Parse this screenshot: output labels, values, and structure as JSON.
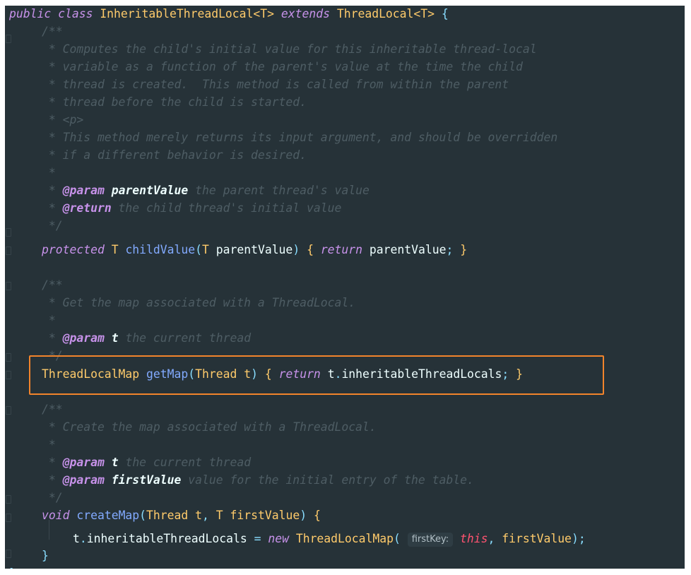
{
  "code": {
    "l1": {
      "kw1": "public",
      "kw2": "class",
      "cls": "InheritableThreadLocal",
      "tp1": "<T>",
      "kw3": "extends",
      "sup": "ThreadLocal",
      "tp2": "<T>",
      "brace": "{"
    },
    "l2": {
      "text": "/**"
    },
    "l3": {
      "text": " * Computes the child's initial value for this inheritable thread-local"
    },
    "l4": {
      "text": " * variable as a function of the parent's value at the time the child"
    },
    "l5": {
      "text": " * thread is created.  This method is called from within the parent"
    },
    "l6": {
      "text": " * thread before the child is started."
    },
    "l7": {
      "text": " * <p>"
    },
    "l8": {
      "text": " * This method merely returns its input argument, and should be overridden"
    },
    "l9": {
      "text": " * if a different behavior is desired."
    },
    "l10": {
      "text": " *"
    },
    "l11": {
      "star": " * ",
      "tag": "@param",
      "param": "parentValue",
      "desc": " the parent thread's value"
    },
    "l12": {
      "star": " * ",
      "tag": "@return",
      "desc": " the child thread's initial value"
    },
    "l13": {
      "text": " */"
    },
    "l14": {
      "kw": "protected",
      "type": "T",
      "fn": "childValue",
      "open": "(",
      "ptype": "T",
      "pname": "parentValue",
      "close": ")",
      "b1": "{",
      "ret": "return",
      "val": "parentValue",
      "semi": ";",
      "b2": "}"
    },
    "l15": {
      "text": "/**"
    },
    "l16": {
      "text": " * Get the map associated with a ThreadLocal."
    },
    "l17": {
      "text": " *"
    },
    "l18": {
      "star": " * ",
      "tag": "@param",
      "param": "t",
      "desc": " the current thread"
    },
    "l19": {
      "text": " */"
    },
    "l20": {
      "type": "ThreadLocalMap",
      "fn": "getMap",
      "open": "(",
      "ptype": "Thread",
      "pname": "t",
      "close": ")",
      "b1": "{",
      "ret": "return",
      "obj": "t",
      "dot": ".",
      "field": "inheritableThreadLocals",
      "semi": ";",
      "b2": "}"
    },
    "l21": {
      "text": "/**"
    },
    "l22": {
      "text": " * Create the map associated with a ThreadLocal."
    },
    "l23": {
      "text": " *"
    },
    "l24": {
      "star": " * ",
      "tag": "@param",
      "param": "t",
      "desc": " the current thread"
    },
    "l25": {
      "star": " * ",
      "tag": "@param",
      "param": "firstValue",
      "desc": " value for the initial entry of the table."
    },
    "l26": {
      "text": " */"
    },
    "l27": {
      "kw": "void",
      "fn": "createMap",
      "open": "(",
      "ptype1": "Thread",
      "pname1": "t",
      "comma": ",",
      "ptype2": "T",
      "pname2": "firstValue",
      "close": ")",
      "b1": "{"
    },
    "l28": {
      "obj": "t",
      "dot": ".",
      "field": "inheritableThreadLocals",
      "eq": "=",
      "kw": "new",
      "type": "ThreadLocalMap",
      "open": "(",
      "hint": "firstKey:",
      "this": "this",
      "comma": ",",
      "arg": "firstValue",
      "close": ")",
      "semi": ";"
    },
    "l29": {
      "b": "}"
    },
    "l30": {
      "b": "}"
    }
  }
}
